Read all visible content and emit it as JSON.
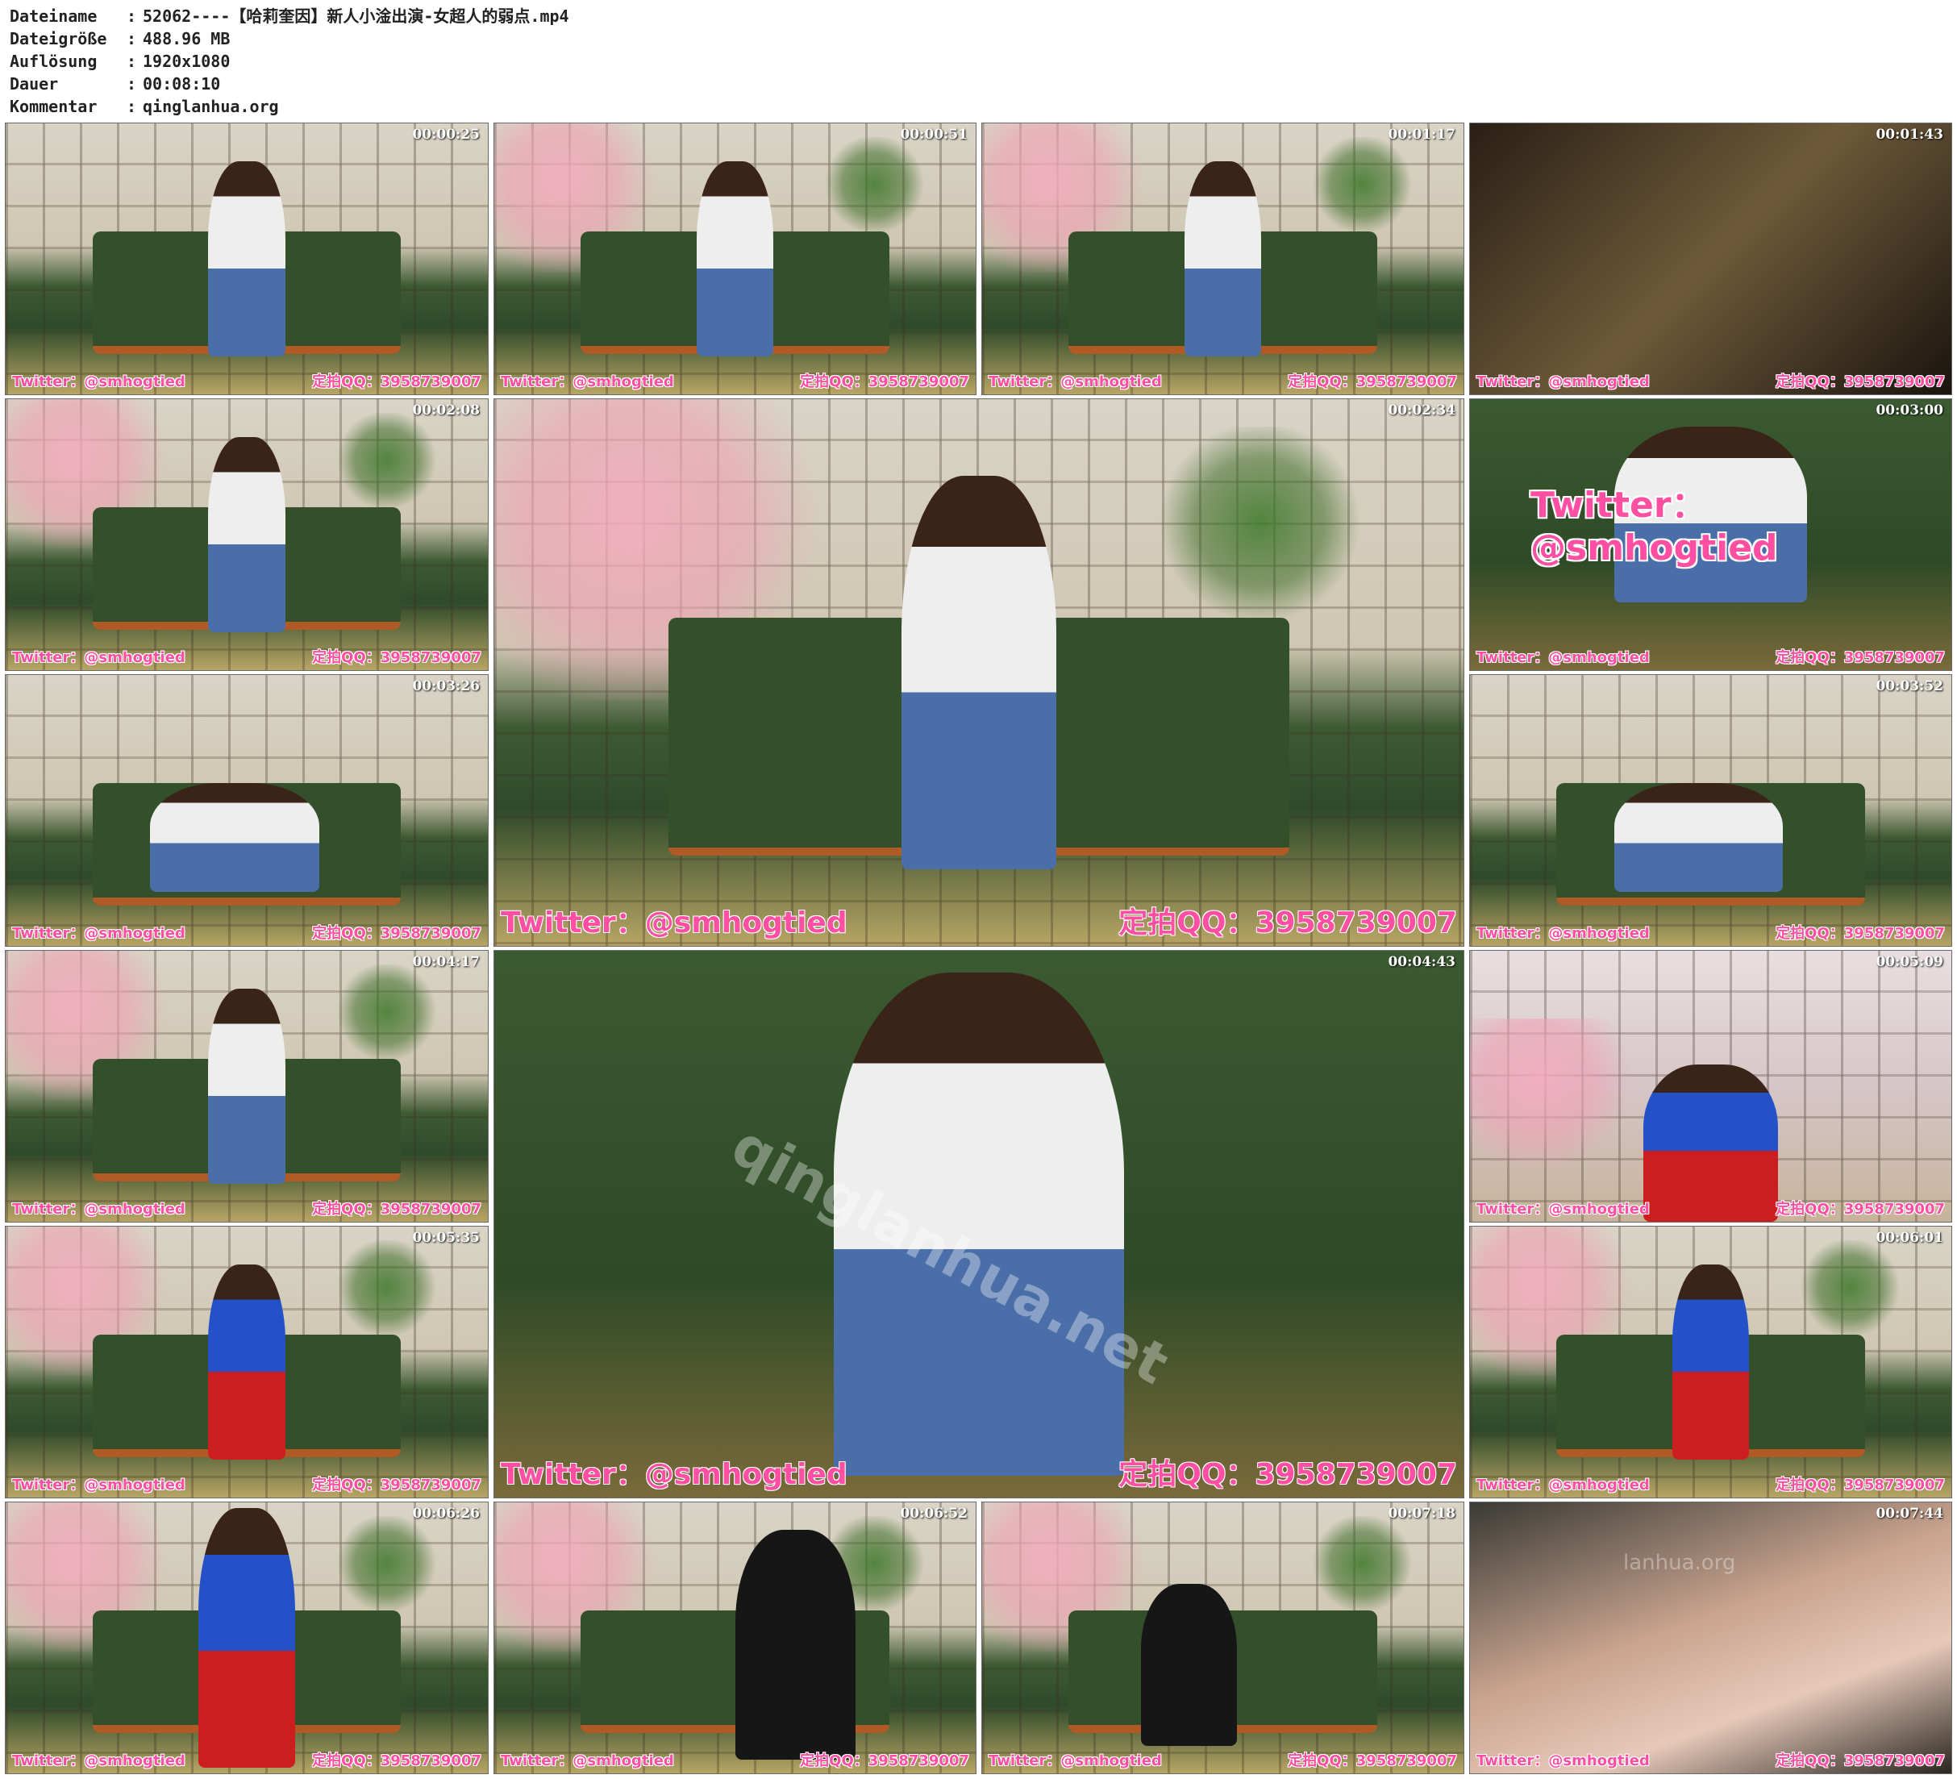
{
  "file_info": [
    {
      "label": "Dateiname",
      "value": "52062----【哈莉奎因】新人小淦出演-女超人的弱点.mp4"
    },
    {
      "label": "Dateigröße",
      "value": "488.96 MB"
    },
    {
      "label": "Auflösung",
      "value": "1920x1080"
    },
    {
      "label": "Dauer",
      "value": "00:08:10"
    },
    {
      "label": "Kommentar",
      "value": "qinglanhua.org"
    }
  ],
  "separator": ":",
  "watermark_left": "Twitter：@smhogtied",
  "watermark_right": "定拍QQ：3958739007",
  "overlay_text": "Twitter：@smhogtied",
  "overlay_site": "qinglanhua.net",
  "overlay_site_small": "lanhua.org",
  "thumbnails": [
    {
      "time": "00:00:25"
    },
    {
      "time": "00:00:51"
    },
    {
      "time": "00:01:17"
    },
    {
      "time": "00:01:43"
    },
    {
      "time": "00:02:08"
    },
    {
      "time": "00:02:34"
    },
    {
      "time": "00:03:00"
    },
    {
      "time": "00:03:26"
    },
    {
      "time": "00:03:52"
    },
    {
      "time": "00:04:17"
    },
    {
      "time": "00:04:43"
    },
    {
      "time": "00:05:09"
    },
    {
      "time": "00:05:35"
    },
    {
      "time": "00:06:01"
    },
    {
      "time": "00:06:26"
    },
    {
      "time": "00:06:52"
    },
    {
      "time": "00:07:18"
    },
    {
      "time": "00:07:44"
    }
  ]
}
